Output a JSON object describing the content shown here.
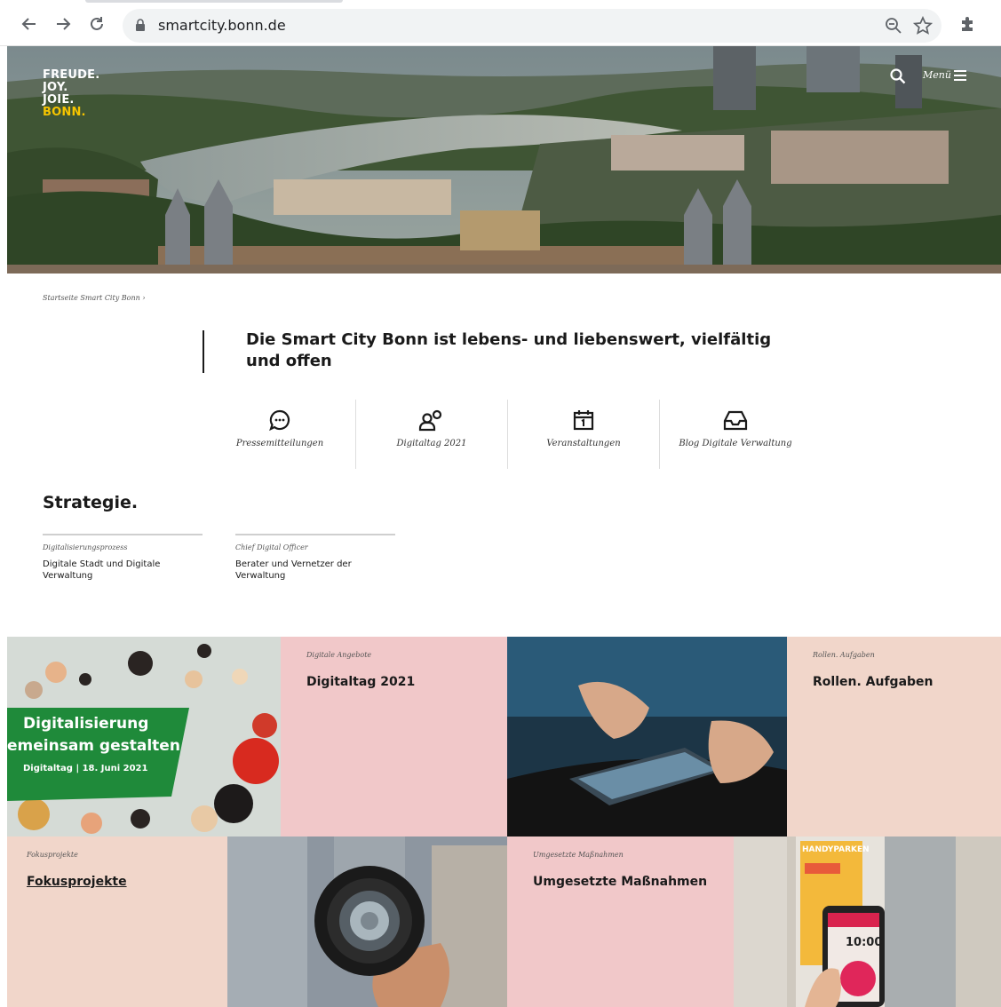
{
  "browser": {
    "url": "smartcity.bonn.de"
  },
  "hero": {
    "logo_lines": [
      "FREUDE.",
      "JOY.",
      "JOIE.",
      "BONN."
    ],
    "menu_label": "Menü"
  },
  "breadcrumb": {
    "text": "Startseite Smart City Bonn ›"
  },
  "headline": {
    "text": "Die Smart City Bonn ist lebens- und liebenswert, vielfältig und offen"
  },
  "quick_links": [
    {
      "label": "Pressemitteilungen",
      "icon": "chat-bubble-icon"
    },
    {
      "label": "Digitaltag 2021",
      "icon": "people-icon"
    },
    {
      "label": "Veranstaltungen",
      "icon": "calendar-icon"
    },
    {
      "label": "Blog Digitale Verwaltung",
      "icon": "inbox-icon"
    }
  ],
  "strategy": {
    "title": "Strategie.",
    "cards": [
      {
        "kicker": "Digitalisierungsprozess",
        "title_line1": "Digitale Stadt und Digitale",
        "title_line2": "Verwaltung"
      },
      {
        "kicker": "Chief Digital Officer",
        "title_line1": "Berater und Vernetzer der",
        "title_line2": "Verwaltung"
      }
    ]
  },
  "tiles": {
    "digitaltag_banner": {
      "line1": "Digitalisierung",
      "line2": "emeinsam gestalten",
      "line3": "Digitaltag | 18. Juni 2021"
    },
    "digitaltag": {
      "kicker": "Digitale Angebote",
      "title": "Digitaltag 2021"
    },
    "rollen": {
      "kicker": "Rollen. Aufgaben",
      "title": "Rollen. Aufgaben"
    },
    "fokus": {
      "kicker": "Fokusprojekte",
      "title": "Fokusprojekte"
    },
    "massnahmen": {
      "kicker": "Umgesetzte Maßnahmen",
      "title": "Umgesetzte Maßnahmen"
    },
    "handyparken": {
      "sign": "HANDYPARKEN",
      "time": "10:00"
    }
  },
  "colors": {
    "pink_tile": "#f1c8c9",
    "peach_tile": "#f1d6ca",
    "logo_yellow": "#f5c400",
    "banner_green": "#1f8a3a"
  }
}
